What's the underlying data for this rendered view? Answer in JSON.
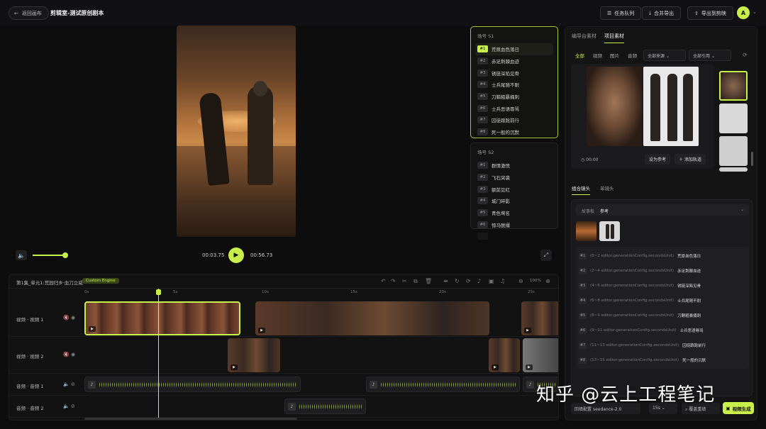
{
  "topbar": {
    "back_label": "返回画布",
    "title": "剪辑室-测试原创剧本",
    "task_queue": "任务队列",
    "merge_export": "合并导出",
    "export_to_editor": "导出到剪映",
    "avatar_letter": "A"
  },
  "player": {
    "current_time": "00:03.75",
    "total_time": "00:56.73",
    "volume_fraction": 0.9
  },
  "scenes": [
    {
      "label": "场号 S1",
      "shots": [
        {
          "num": "#1",
          "title": "荒原血色落日",
          "active": true
        },
        {
          "num": "#2",
          "title": "赤足荆棘血迹"
        },
        {
          "num": "#3",
          "title": "锈链深陷见骨"
        },
        {
          "num": "#4",
          "title": "士兵尾随不耐"
        },
        {
          "num": "#5",
          "title": "刀鞘粗暴捅刺"
        },
        {
          "num": "#6",
          "title": "士兵恶语辱骂"
        },
        {
          "num": "#7",
          "title": "囚徒踉跄前行"
        },
        {
          "num": "#8",
          "title": "死一般的沉默"
        }
      ]
    },
    {
      "label": "场号 S2",
      "shots": [
        {
          "num": "#1",
          "title": "群情激愤"
        },
        {
          "num": "#2",
          "title": "飞石突袭"
        },
        {
          "num": "#3",
          "title": "额前见红"
        },
        {
          "num": "#4",
          "title": "城门碎影"
        },
        {
          "num": "#5",
          "title": "青色莺名"
        },
        {
          "num": "#6",
          "title": "惊马脱缰"
        }
      ]
    }
  ],
  "timeline": {
    "title": "第1集_单元1:荒园归乡·血刀立威",
    "engine_badge": "Custom Engine",
    "zoom": "100%",
    "ruler": [
      "0s",
      "5s",
      "10s",
      "15s",
      "20s",
      "25s"
    ],
    "tracks": [
      {
        "label": "视频 · 视频 1"
      },
      {
        "label": "视频 · 视频 2"
      },
      {
        "label": "音频 · 音频 1"
      },
      {
        "label": "音频 · 音频 2"
      }
    ]
  },
  "right_panel": {
    "tabs": [
      "编导台素材",
      "项目素材"
    ],
    "active_tab": 1,
    "filters": [
      "全部",
      "视频",
      "图片",
      "音频"
    ],
    "source_dropdown": "全部来源",
    "usage_dropdown": "全部引用",
    "asset_time": "00:00",
    "set_reference": "设为参考",
    "add_track": "添加轨道",
    "subtabs": [
      "组合镜头",
      "单镜头"
    ],
    "storyboard_label": "故事板",
    "storyboard_value": "参考",
    "units": [
      {
        "num": "#1",
        "code": "(0~2 editor.generationConfig.secondsUnit)",
        "name": "荒原血色落日"
      },
      {
        "num": "#2",
        "code": "(2~4 editor.generationConfig.secondsUnit)",
        "name": "赤足荆棘血迹"
      },
      {
        "num": "#3",
        "code": "(4~6 editor.generationConfig.secondsUnit)",
        "name": "锈链深陷见骨"
      },
      {
        "num": "#4",
        "code": "(6~8 editor.generationConfig.secondsUnit)",
        "name": "士兵尾随不耐"
      },
      {
        "num": "#5",
        "code": "(8~9 editor.generationConfig.secondsUnit)",
        "name": "刀鞘粗暴捅刺"
      },
      {
        "num": "#6",
        "code": "(9~11 editor.generationConfig.secondsUnit)",
        "name": "士兵恶语辱骂"
      },
      {
        "num": "#7",
        "code": "(11~13 editor.generationConfig.secondsUnit)",
        "name": "囚徒踉跄前行"
      },
      {
        "num": "#8",
        "code": "(13~15 editor.generationConfig.secondsUnit)",
        "name": "死一般的沉默"
      }
    ],
    "config_label": "回填配置",
    "model": "seedance-2.0",
    "duration": "15s",
    "override_label": "覆盖重填",
    "generate_label": "视频生成"
  },
  "watermark": "知乎 @云上工程笔记",
  "colors": {
    "accent": "#c9f04a",
    "background": "#0d0d0e",
    "mute_red": "#e2453f"
  }
}
